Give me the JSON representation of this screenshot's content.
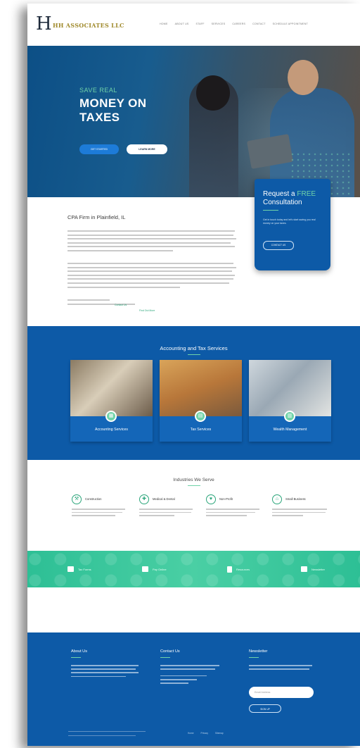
{
  "header": {
    "logo_mark": "H",
    "logo_text": "HH ASSOCIATES LLC",
    "nav": [
      "HOME",
      "ABOUT US",
      "STAFF",
      "SERVICES",
      "CAREERS",
      "CONTACT",
      "SCHEDULE APPOINTMENT"
    ]
  },
  "hero": {
    "eyebrow": "SAVE REAL",
    "title_line1": "MONEY ON",
    "title_line2": "TAXES",
    "btn_primary": "GET STARTED",
    "btn_secondary": "LEARN MORE"
  },
  "consult": {
    "title_part1": "Request a ",
    "title_highlight": "FREE",
    "title_part2": "Consultation",
    "text": "Get in touch today and let's start saving you real money on your taxes.",
    "button": "CONTACT US"
  },
  "about": {
    "title": "CPA Firm in Plainfield, IL",
    "link1": "Contact Us",
    "link2": "Find Out More"
  },
  "services": {
    "title": "Accounting and Tax Services",
    "cards": [
      {
        "label": "Accounting Services",
        "icon": "calculator-icon"
      },
      {
        "label": "Tax Services",
        "icon": "document-icon"
      },
      {
        "label": "Wealth Management",
        "icon": "chart-icon"
      }
    ]
  },
  "industries": {
    "title": "Industries We Serve",
    "items": [
      {
        "name": "Construction"
      },
      {
        "name": "Medical & Dental"
      },
      {
        "name": "Non-Profit"
      },
      {
        "name": "Small Business"
      }
    ]
  },
  "band": {
    "items": [
      "Tax Forms",
      "Pay Online",
      "Resources",
      "Newsletter"
    ]
  },
  "footer": {
    "about_title": "About Us",
    "contact_title": "Contact Us",
    "news_title": "Newsletter",
    "email_placeholder": "Email Address",
    "signup_button": "SIGN UP",
    "bottom_links": [
      "Home",
      "Privacy",
      "Sitemap"
    ]
  },
  "colors": {
    "primary": "#0d5aa7",
    "accent": "#6fd3a8",
    "band": "#2dbf95"
  }
}
